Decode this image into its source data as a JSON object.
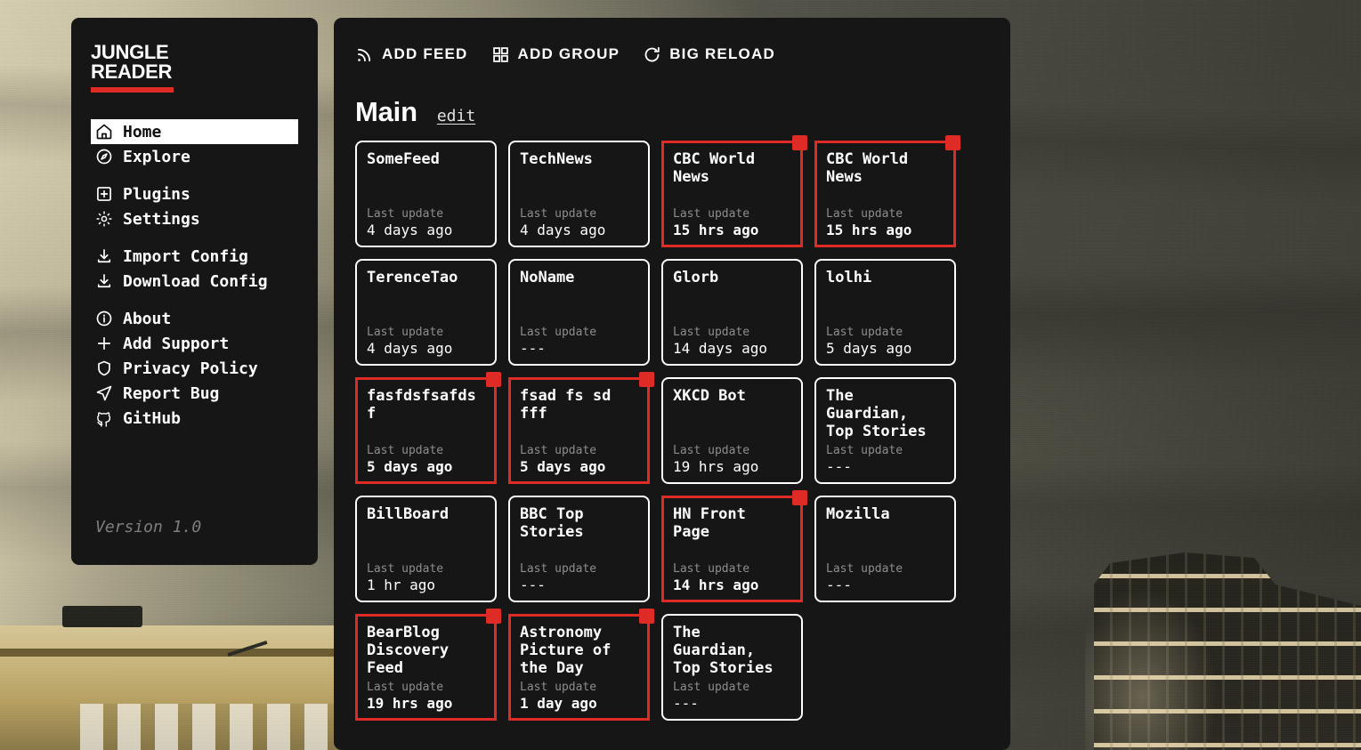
{
  "app": {
    "logo_line1": "JUNGLE",
    "logo_line2": "READER",
    "version": "Version 1.0",
    "accent_color": "#de2b26",
    "panel_color": "#161616"
  },
  "sidebar": {
    "groups": [
      {
        "items": [
          {
            "label": "Home",
            "icon": "home-icon",
            "active": true
          },
          {
            "label": "Explore",
            "icon": "compass-icon",
            "active": false
          }
        ]
      },
      {
        "items": [
          {
            "label": "Plugins",
            "icon": "plus-square-icon",
            "active": false
          },
          {
            "label": "Settings",
            "icon": "gear-icon",
            "active": false
          }
        ]
      },
      {
        "items": [
          {
            "label": "Import Config",
            "icon": "download-icon",
            "active": false
          },
          {
            "label": "Download Config",
            "icon": "download-icon",
            "active": false
          }
        ]
      },
      {
        "items": [
          {
            "label": "About",
            "icon": "info-circle-icon",
            "active": false
          },
          {
            "label": "Add Support",
            "icon": "plus-icon",
            "active": false
          },
          {
            "label": "Privacy Policy",
            "icon": "shield-icon",
            "active": false
          },
          {
            "label": "Report Bug",
            "icon": "send-icon",
            "active": false
          },
          {
            "label": "GitHub",
            "icon": "github-icon",
            "active": false
          }
        ]
      }
    ]
  },
  "toolbar": {
    "buttons": [
      {
        "label": "ADD FEED",
        "icon": "rss-icon"
      },
      {
        "label": "ADD GROUP",
        "icon": "grid-icon"
      },
      {
        "label": "BIG RELOAD",
        "icon": "reload-icon"
      }
    ]
  },
  "group": {
    "title": "Main",
    "edit_label": "edit",
    "meta_label": "Last update",
    "feeds": [
      {
        "title": "SomeFeed",
        "last_update": "4 days ago",
        "unread": false
      },
      {
        "title": "TechNews",
        "last_update": "4 days ago",
        "unread": false
      },
      {
        "title": "CBC World News",
        "last_update": "15 hrs ago",
        "unread": true
      },
      {
        "title": "CBC World News",
        "last_update": "15 hrs ago",
        "unread": true
      },
      {
        "title": "TerenceTao",
        "last_update": "4 days ago",
        "unread": false
      },
      {
        "title": "NoName",
        "last_update": "---",
        "unread": false
      },
      {
        "title": "Glorb",
        "last_update": "14 days ago",
        "unread": false
      },
      {
        "title": "lolhi",
        "last_update": "5 days ago",
        "unread": false
      },
      {
        "title": "fasfdsfsafdsf",
        "last_update": "5 days ago",
        "unread": true
      },
      {
        "title": "fsad fs sd fff",
        "last_update": "5 days ago",
        "unread": true
      },
      {
        "title": "XKCD Bot",
        "last_update": "19 hrs ago",
        "unread": false
      },
      {
        "title": "The Guardian, Top Stories",
        "last_update": "---",
        "unread": false
      },
      {
        "title": "BillBoard",
        "last_update": "1 hr ago",
        "unread": false
      },
      {
        "title": "BBC Top Stories",
        "last_update": "---",
        "unread": false
      },
      {
        "title": "HN Front Page",
        "last_update": "14 hrs ago",
        "unread": true
      },
      {
        "title": "Mozilla",
        "last_update": "---",
        "unread": false
      },
      {
        "title": "BearBlog Discovery Feed",
        "last_update": "19 hrs ago",
        "unread": true
      },
      {
        "title": "Astronomy Picture of the Day",
        "last_update": "1 day ago",
        "unread": true
      },
      {
        "title": "The Guardian, Top Stories",
        "last_update": "---",
        "unread": false
      }
    ]
  }
}
